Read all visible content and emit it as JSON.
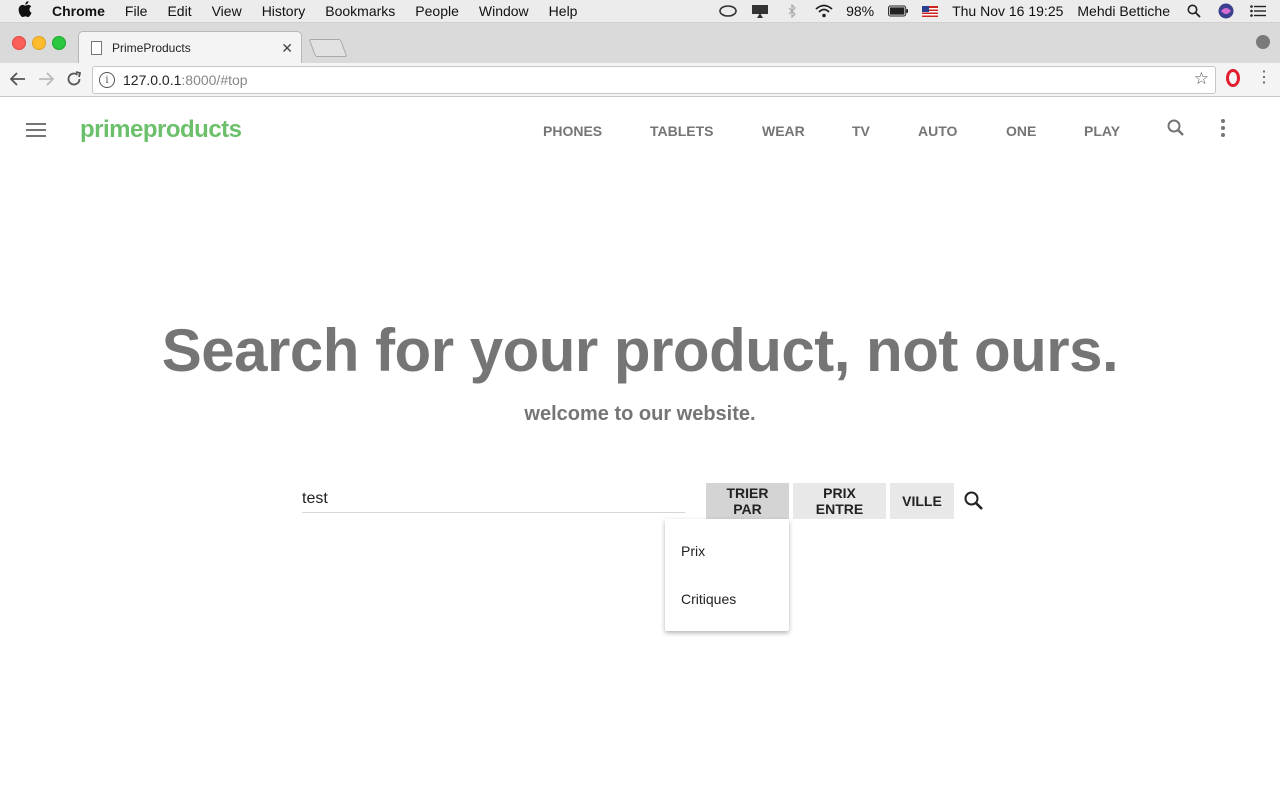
{
  "menubar": {
    "app_name": "Chrome",
    "items": [
      "File",
      "Edit",
      "View",
      "History",
      "Bookmarks",
      "People",
      "Window",
      "Help"
    ],
    "battery": "98%",
    "datetime": "Thu Nov 16  19:25",
    "user": "Mehdi Bettiche"
  },
  "browser": {
    "tab_title": "PrimeProducts",
    "url_host": "127.0.0.1",
    "url_rest": ":8000/#top"
  },
  "site": {
    "brand": "primeproducts",
    "brand_color": "#6cc06b",
    "nav": [
      "PHONES",
      "TABLETS",
      "WEAR",
      "TV",
      "AUTO",
      "ONE",
      "PLAY"
    ]
  },
  "hero": {
    "title": "Search for your product, not ours.",
    "subtitle": "welcome to our website."
  },
  "search": {
    "value": "test",
    "filters": [
      "TRIER PAR",
      "PRIX ENTRE",
      "VILLE"
    ],
    "active_filter": "TRIER PAR"
  },
  "dropdown": {
    "options": [
      "Prix",
      "Critiques"
    ]
  }
}
